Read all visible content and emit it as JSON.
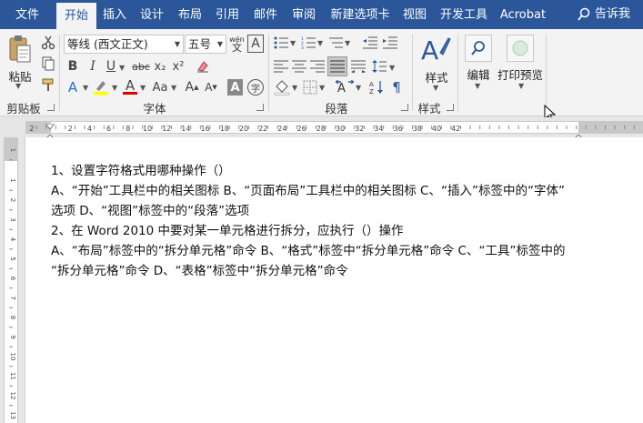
{
  "tabs": [
    "文件",
    "开始",
    "插入",
    "设计",
    "布局",
    "引用",
    "邮件",
    "审阅",
    "新建选项卡",
    "视图",
    "开发工具",
    "Acrobat"
  ],
  "active_tab": "开始",
  "tell_me": "告诉我",
  "clipboard": {
    "paste_label": "粘贴",
    "group_label": "剪贴板"
  },
  "font": {
    "font_name": "等线 (西文正文)",
    "font_size": "五号",
    "group_label": "字体",
    "bold": "B",
    "italic": "I",
    "underline": "U",
    "strikethrough": "abc",
    "subscript": "x₂",
    "superscript": "x²",
    "grow_font": "A",
    "shrink_font": "A",
    "change_case": "Aa",
    "phonetic_guide": "wén",
    "char_border": "A",
    "char_shading": "A",
    "enclose_char": "字"
  },
  "paragraph": {
    "group_label": "段落"
  },
  "styles": {
    "button_label": "样式",
    "group_label": "样式"
  },
  "editing": {
    "button_label": "编辑"
  },
  "print_preview": {
    "button_label": "打印预览"
  },
  "ruler_numbers": [
    "2",
    "2",
    "4",
    "6",
    "8",
    "10",
    "12",
    "14",
    "16",
    "18",
    "20",
    "22",
    "24",
    "26",
    "28",
    "30",
    "32",
    "34",
    "36",
    "38",
    "40",
    "42"
  ],
  "vruler_numbers": [
    "1",
    "1",
    "2",
    "3",
    "4",
    "5",
    "6",
    "7",
    "8",
    "9",
    "10",
    "11",
    "12",
    "13"
  ],
  "document": {
    "lines": [
      "1、设置字符格式用哪种操作（）",
      "A、“开始”工具栏中的相关图标 B、“页面布局”工具栏中的相关图标 C、“插入”标签中的“字体”",
      "选项 D、“视图”标签中的“段落”选项",
      "2、在 Word 2010 中要对某一单元格进行拆分，应执行（）操作",
      "A、“布局”标签中的“拆分单元格”命令 B、“格式”标签中“拆分单元格”命令 C、“工具”标签中的",
      "“拆分单元格”命令 D、“表格”标签中“拆分单元格”命令"
    ]
  },
  "colors": {
    "tab_bar": "#2b579a",
    "ribbon": "#f3f3f3",
    "highlight": "#ffff00",
    "font_color": "#e00000"
  }
}
